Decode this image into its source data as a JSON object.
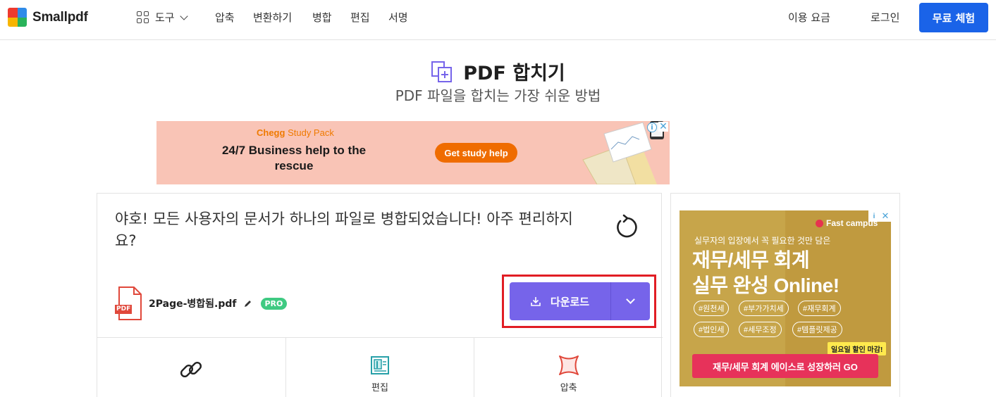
{
  "nav": {
    "logo_text": "Smallpdf",
    "tools_label": "도구",
    "links": [
      "압축",
      "변환하기",
      "병합",
      "편집",
      "서명"
    ],
    "pricing": "이용 요금",
    "login": "로그인",
    "trial": "무료 체험"
  },
  "page": {
    "title": "PDF 합치기",
    "subtitle": "PDF 파일을 합치는 가장 쉬운 방법"
  },
  "top_ad": {
    "brand": "Chegg",
    "brand_suffix": "Study Pack",
    "headline": "24/7 Business help to the rescue",
    "cta": "Get study help",
    "info": "i",
    "close": "✕"
  },
  "result": {
    "message": "야호! 모든 사용자의 문서가 하나의 파일로 병합되었습니다! 아주 편리하지요?",
    "file_badge": "PDF",
    "file_name": "2Page-병합됨.pdf",
    "pro_badge": "PRO",
    "download_label": "다운로드",
    "colors": {
      "download": "#7664ea",
      "highlight": "#e11d24",
      "pro": "#3fca82"
    }
  },
  "tools": [
    {
      "label": "",
      "icon": "link-icon"
    },
    {
      "label": "편집",
      "icon": "edit-doc-icon"
    },
    {
      "label": "압축",
      "icon": "compress-icon"
    }
  ],
  "side_ad": {
    "brand": "Fast campus",
    "sub": "실무자의 입장에서 꼭 필요한 것만 담은",
    "headline_1": "재무/세무 회계",
    "headline_2": "실무 완성 Online!",
    "tags": [
      "#원천세",
      "#부가가치세",
      "#재무회계",
      "#법인세",
      "#세무조정",
      "#템플릿제공"
    ],
    "badge": "일요일 할인 마감!",
    "cta": "재무/세무 회계 에이스로 성장하러 GO",
    "info": "i",
    "close": "✕"
  }
}
